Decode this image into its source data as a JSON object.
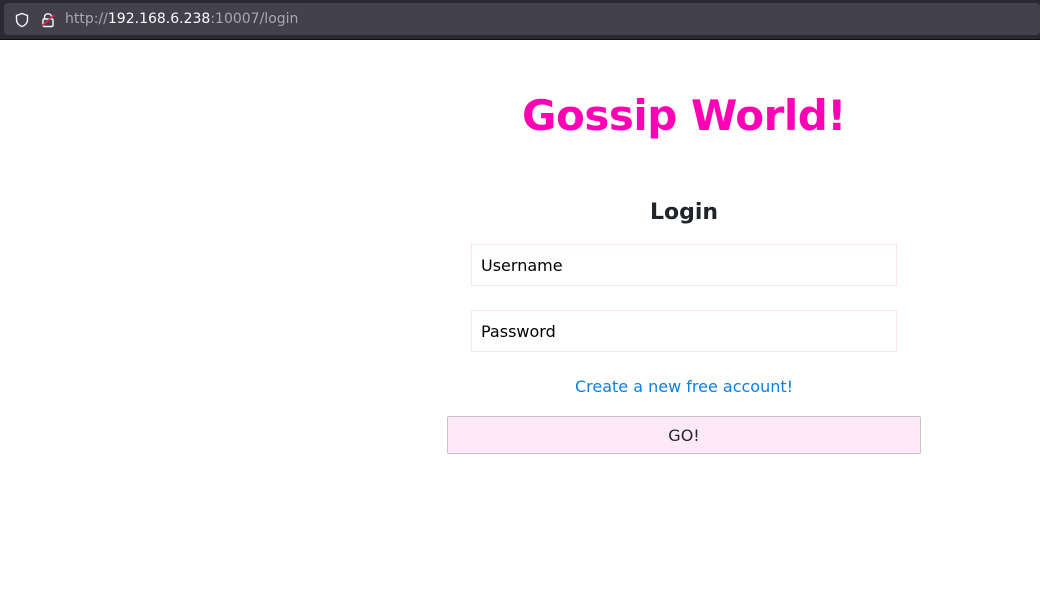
{
  "browser": {
    "url_scheme": "http://",
    "url_host": "192.168.6.238",
    "url_rest": ":10007/login"
  },
  "page": {
    "app_title": "Gossip World!",
    "login_heading": "Login",
    "username_placeholder": "Username",
    "password_placeholder": "Password",
    "signup_link": "Create a new free account!",
    "go_button": "GO!"
  },
  "colors": {
    "title": "#ff00b4",
    "link": "#0d7fe0",
    "button_bg": "#ffe8f8"
  },
  "icons": {
    "tracking_protection": "shield-icon",
    "insecure_connection": "lock-icon"
  }
}
